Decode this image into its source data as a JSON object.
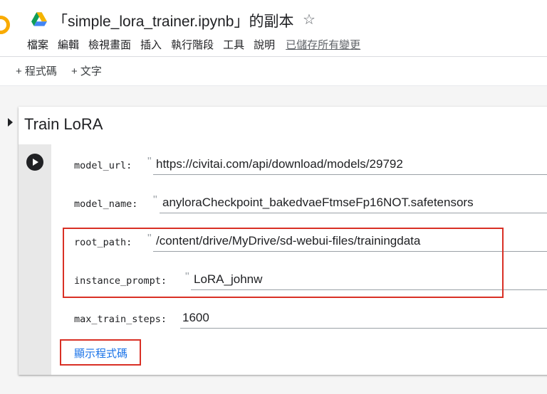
{
  "header": {
    "title": "「simple_lora_trainer.ipynb」的副本",
    "star_icon": "star-outline-icon",
    "menu": [
      "檔案",
      "編輯",
      "檢視畫面",
      "插入",
      "執行階段",
      "工具",
      "說明"
    ],
    "saved_status": "已儲存所有變更"
  },
  "toolbar": {
    "add_code": "+ 程式碼",
    "add_text": "+ 文字"
  },
  "cell": {
    "title": "Train LoRA",
    "params": [
      {
        "label": "model_url:",
        "value": "https://civitai.com/api/download/models/29792"
      },
      {
        "label": "model_name:",
        "value": "anyloraCheckpoint_bakedvaeFtmseFp16NOT.safetensors"
      },
      {
        "label": "root_path:",
        "value": "/content/drive/MyDrive/sd-webui-files/trainingdata"
      },
      {
        "label": "instance_prompt:",
        "value": "LoRA_johnw"
      },
      {
        "label": "max_train_steps:",
        "value": "1600"
      }
    ],
    "show_code": "顯示程式碼"
  },
  "colors": {
    "highlight": "#d93025",
    "link": "#1a73e8",
    "logo": "#f9ab00"
  }
}
